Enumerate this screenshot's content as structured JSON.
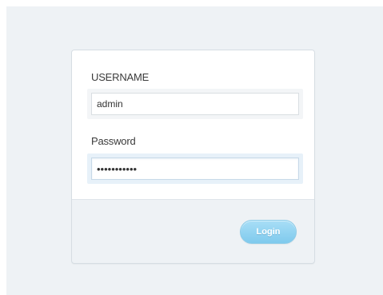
{
  "login_form": {
    "username": {
      "label": "USERNAME",
      "value": "admin"
    },
    "password": {
      "label": "Password",
      "value": "•••••••••••"
    },
    "submit_label": "Login"
  },
  "colors": {
    "page_background": "#eef2f5",
    "panel_body": "#ffffff",
    "button_accent": "#7fcaed",
    "label_text": "#3b3b3b"
  }
}
